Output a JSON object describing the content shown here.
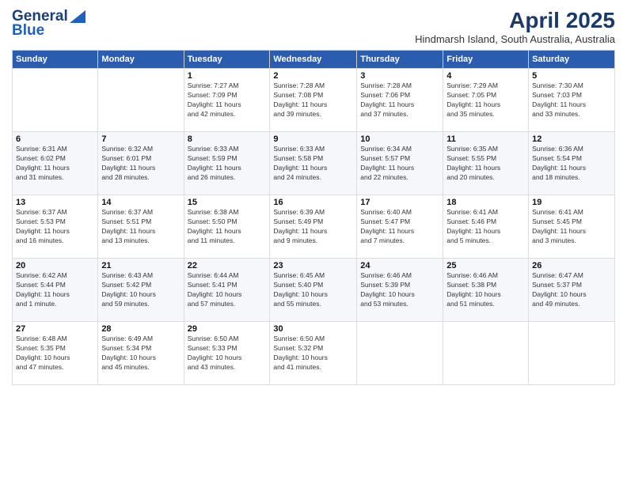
{
  "header": {
    "logo_general": "General",
    "logo_blue": "Blue",
    "month_title": "April 2025",
    "subtitle": "Hindmarsh Island, South Australia, Australia"
  },
  "days_of_week": [
    "Sunday",
    "Monday",
    "Tuesday",
    "Wednesday",
    "Thursday",
    "Friday",
    "Saturday"
  ],
  "weeks": [
    [
      {
        "day": "",
        "info": ""
      },
      {
        "day": "",
        "info": ""
      },
      {
        "day": "1",
        "info": "Sunrise: 7:27 AM\nSunset: 7:09 PM\nDaylight: 11 hours\nand 42 minutes."
      },
      {
        "day": "2",
        "info": "Sunrise: 7:28 AM\nSunset: 7:08 PM\nDaylight: 11 hours\nand 39 minutes."
      },
      {
        "day": "3",
        "info": "Sunrise: 7:28 AM\nSunset: 7:06 PM\nDaylight: 11 hours\nand 37 minutes."
      },
      {
        "day": "4",
        "info": "Sunrise: 7:29 AM\nSunset: 7:05 PM\nDaylight: 11 hours\nand 35 minutes."
      },
      {
        "day": "5",
        "info": "Sunrise: 7:30 AM\nSunset: 7:03 PM\nDaylight: 11 hours\nand 33 minutes."
      }
    ],
    [
      {
        "day": "6",
        "info": "Sunrise: 6:31 AM\nSunset: 6:02 PM\nDaylight: 11 hours\nand 31 minutes."
      },
      {
        "day": "7",
        "info": "Sunrise: 6:32 AM\nSunset: 6:01 PM\nDaylight: 11 hours\nand 28 minutes."
      },
      {
        "day": "8",
        "info": "Sunrise: 6:33 AM\nSunset: 5:59 PM\nDaylight: 11 hours\nand 26 minutes."
      },
      {
        "day": "9",
        "info": "Sunrise: 6:33 AM\nSunset: 5:58 PM\nDaylight: 11 hours\nand 24 minutes."
      },
      {
        "day": "10",
        "info": "Sunrise: 6:34 AM\nSunset: 5:57 PM\nDaylight: 11 hours\nand 22 minutes."
      },
      {
        "day": "11",
        "info": "Sunrise: 6:35 AM\nSunset: 5:55 PM\nDaylight: 11 hours\nand 20 minutes."
      },
      {
        "day": "12",
        "info": "Sunrise: 6:36 AM\nSunset: 5:54 PM\nDaylight: 11 hours\nand 18 minutes."
      }
    ],
    [
      {
        "day": "13",
        "info": "Sunrise: 6:37 AM\nSunset: 5:53 PM\nDaylight: 11 hours\nand 16 minutes."
      },
      {
        "day": "14",
        "info": "Sunrise: 6:37 AM\nSunset: 5:51 PM\nDaylight: 11 hours\nand 13 minutes."
      },
      {
        "day": "15",
        "info": "Sunrise: 6:38 AM\nSunset: 5:50 PM\nDaylight: 11 hours\nand 11 minutes."
      },
      {
        "day": "16",
        "info": "Sunrise: 6:39 AM\nSunset: 5:49 PM\nDaylight: 11 hours\nand 9 minutes."
      },
      {
        "day": "17",
        "info": "Sunrise: 6:40 AM\nSunset: 5:47 PM\nDaylight: 11 hours\nand 7 minutes."
      },
      {
        "day": "18",
        "info": "Sunrise: 6:41 AM\nSunset: 5:46 PM\nDaylight: 11 hours\nand 5 minutes."
      },
      {
        "day": "19",
        "info": "Sunrise: 6:41 AM\nSunset: 5:45 PM\nDaylight: 11 hours\nand 3 minutes."
      }
    ],
    [
      {
        "day": "20",
        "info": "Sunrise: 6:42 AM\nSunset: 5:44 PM\nDaylight: 11 hours\nand 1 minute."
      },
      {
        "day": "21",
        "info": "Sunrise: 6:43 AM\nSunset: 5:42 PM\nDaylight: 10 hours\nand 59 minutes."
      },
      {
        "day": "22",
        "info": "Sunrise: 6:44 AM\nSunset: 5:41 PM\nDaylight: 10 hours\nand 57 minutes."
      },
      {
        "day": "23",
        "info": "Sunrise: 6:45 AM\nSunset: 5:40 PM\nDaylight: 10 hours\nand 55 minutes."
      },
      {
        "day": "24",
        "info": "Sunrise: 6:46 AM\nSunset: 5:39 PM\nDaylight: 10 hours\nand 53 minutes."
      },
      {
        "day": "25",
        "info": "Sunrise: 6:46 AM\nSunset: 5:38 PM\nDaylight: 10 hours\nand 51 minutes."
      },
      {
        "day": "26",
        "info": "Sunrise: 6:47 AM\nSunset: 5:37 PM\nDaylight: 10 hours\nand 49 minutes."
      }
    ],
    [
      {
        "day": "27",
        "info": "Sunrise: 6:48 AM\nSunset: 5:35 PM\nDaylight: 10 hours\nand 47 minutes."
      },
      {
        "day": "28",
        "info": "Sunrise: 6:49 AM\nSunset: 5:34 PM\nDaylight: 10 hours\nand 45 minutes."
      },
      {
        "day": "29",
        "info": "Sunrise: 6:50 AM\nSunset: 5:33 PM\nDaylight: 10 hours\nand 43 minutes."
      },
      {
        "day": "30",
        "info": "Sunrise: 6:50 AM\nSunset: 5:32 PM\nDaylight: 10 hours\nand 41 minutes."
      },
      {
        "day": "",
        "info": ""
      },
      {
        "day": "",
        "info": ""
      },
      {
        "day": "",
        "info": ""
      }
    ]
  ]
}
